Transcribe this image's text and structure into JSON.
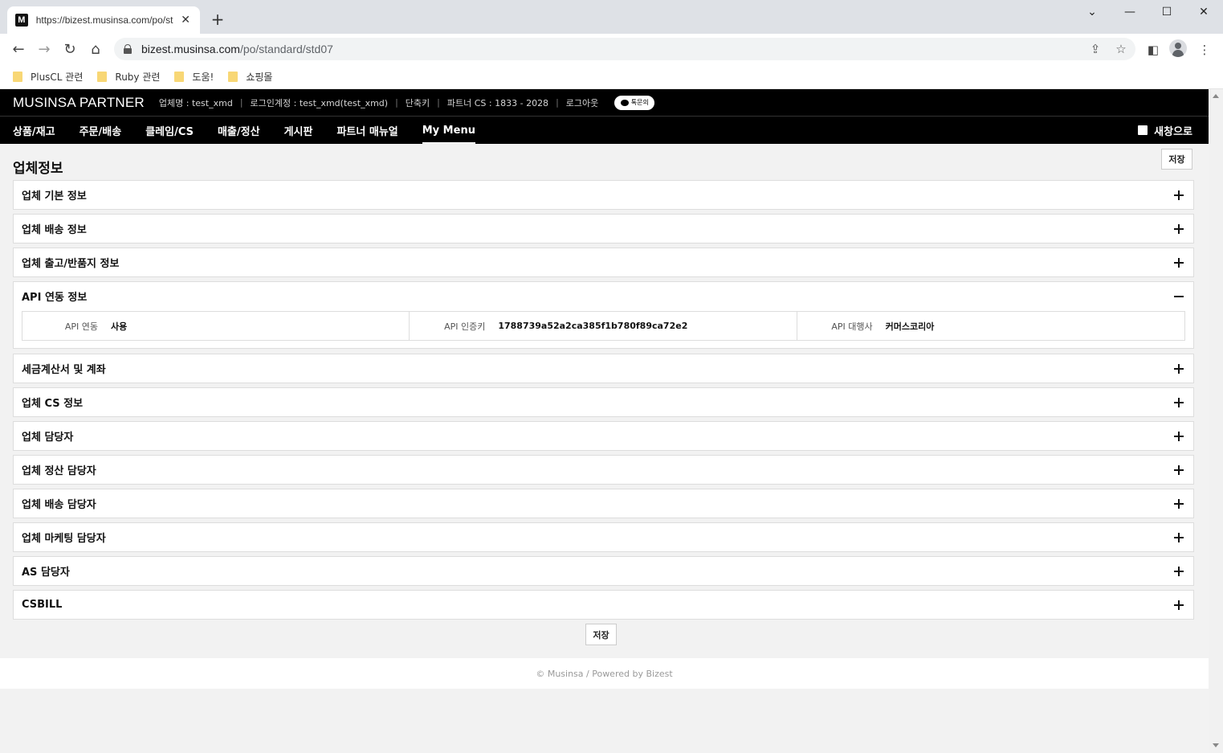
{
  "browser": {
    "tab_title": "https://bizest.musinsa.com/po/st",
    "favicon_letter": "M",
    "url_domain": "bizest.musinsa.com",
    "url_path": "/po/standard/std07",
    "bookmarks": [
      "PlusCL 관련",
      "Ruby 관련",
      "도움!",
      "쇼핑몰"
    ],
    "icons": {
      "back": "back-arrow-icon",
      "forward": "forward-arrow-icon",
      "reload": "reload-icon",
      "home": "home-icon",
      "share": "share-icon",
      "star": "bookmark-star-icon",
      "sidepanel": "side-panel-icon",
      "profile": "profile-icon",
      "menu": "kebab-menu-icon"
    }
  },
  "header": {
    "logo": "MUSINSA PARTNER",
    "company": "업체명 : test_xmd",
    "login_account": "로그인계정 : test_xmd(test_xmd)",
    "shortcut": "단축키",
    "partner_cs": "파트너 CS : 1833 - 2028",
    "logout": "로그아웃",
    "talk_label": "톡문의"
  },
  "menu": {
    "items": [
      "상품/재고",
      "주문/배송",
      "클레임/CS",
      "매출/정산",
      "게시판",
      "파트너 매뉴얼",
      "My Menu"
    ],
    "active_index": 6,
    "new_window": "새창으로"
  },
  "page": {
    "title": "업체정보",
    "save_top": "저장",
    "save_bottom": "저장",
    "sections": [
      "업체 기본 정보",
      "업체 배송 정보",
      "업체 출고/반품지 정보",
      "API 연동 정보",
      "세금계산서 및 계좌",
      "업체 CS 정보",
      "업체 담당자",
      "업체 정산 담당자",
      "업체 배송 담당자",
      "업체 마케팅 담당자",
      "AS 담당자",
      "CSBILL"
    ],
    "expanded_index": 3,
    "api": {
      "integration_label": "API 연동",
      "integration_value": "사용",
      "key_label": "API 인증키",
      "key_value": "1788739a52a2ca385f1b780f89ca72e2",
      "agency_label": "API 대행사",
      "agency_value": "커머스코리아"
    }
  },
  "footer": {
    "text": "© Musinsa / Powered by Bizest"
  }
}
